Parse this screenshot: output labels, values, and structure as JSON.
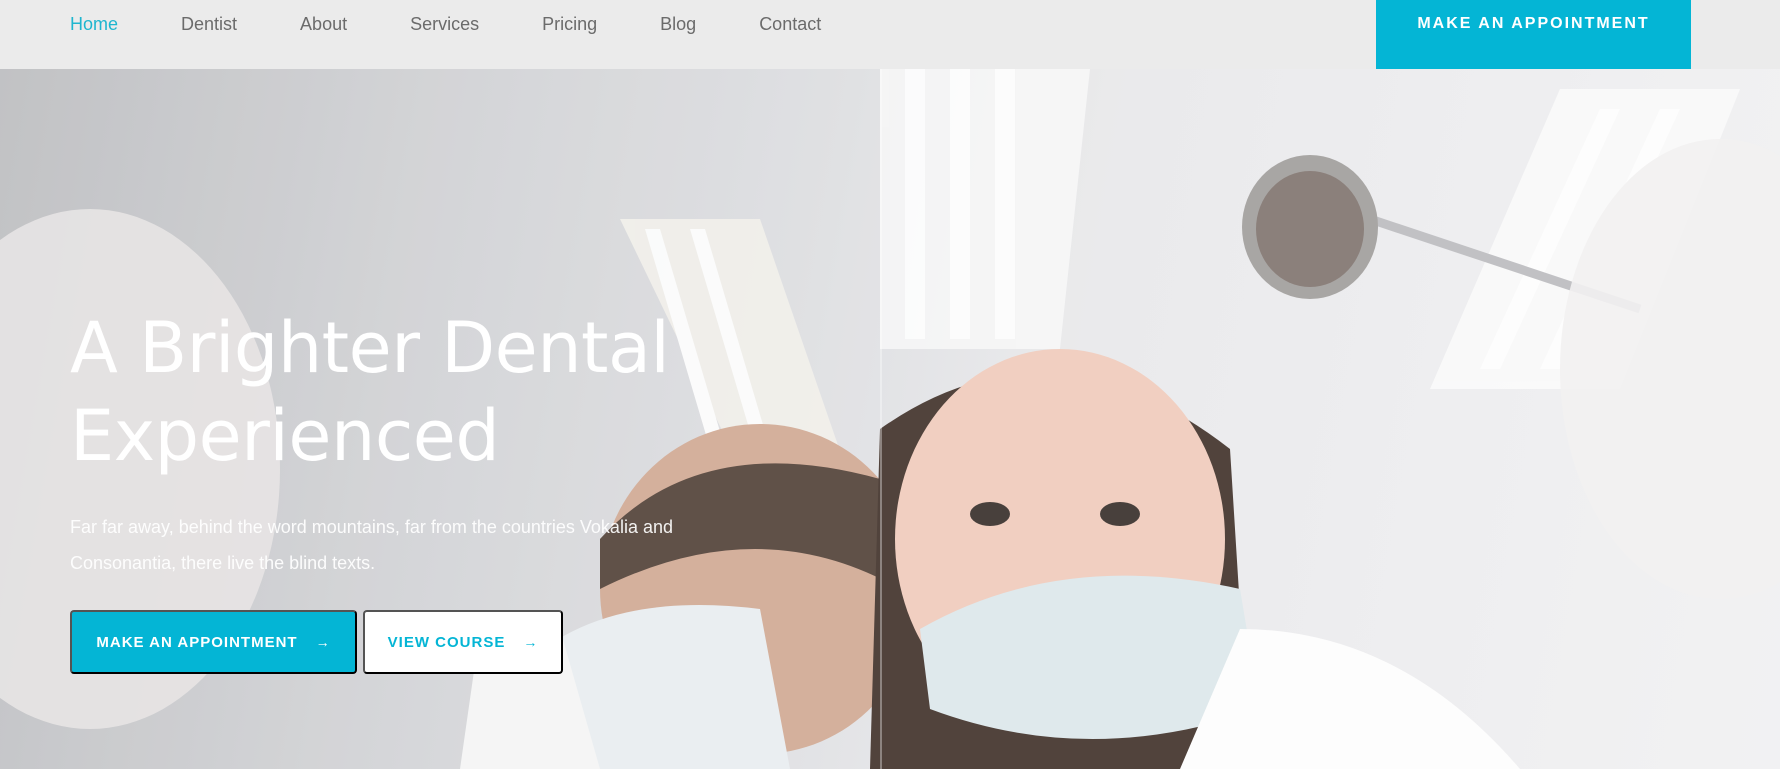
{
  "nav": {
    "items": [
      {
        "label": "Home",
        "active": true
      },
      {
        "label": "Dentist",
        "active": false
      },
      {
        "label": "About",
        "active": false
      },
      {
        "label": "Services",
        "active": false
      },
      {
        "label": "Pricing",
        "active": false
      },
      {
        "label": "Blog",
        "active": false
      },
      {
        "label": "Contact",
        "active": false
      }
    ],
    "cta_label": "MAKE AN APPOINTMENT"
  },
  "hero": {
    "title_line1": "A Brighter Dental",
    "title_line2": "Experienced",
    "text": "Far far away, behind the word mountains, far from the countries Vokalia and Consonantia, there live the blind texts.",
    "primary_button": "MAKE AN APPOINTMENT",
    "secondary_button": "VIEW COURSE",
    "arrow_glyph": "→"
  },
  "colors": {
    "accent": "#04b5d5",
    "nav_bg": "#ebebeb",
    "nav_text": "#6b6b6b",
    "nav_active": "#1eb6cf"
  }
}
